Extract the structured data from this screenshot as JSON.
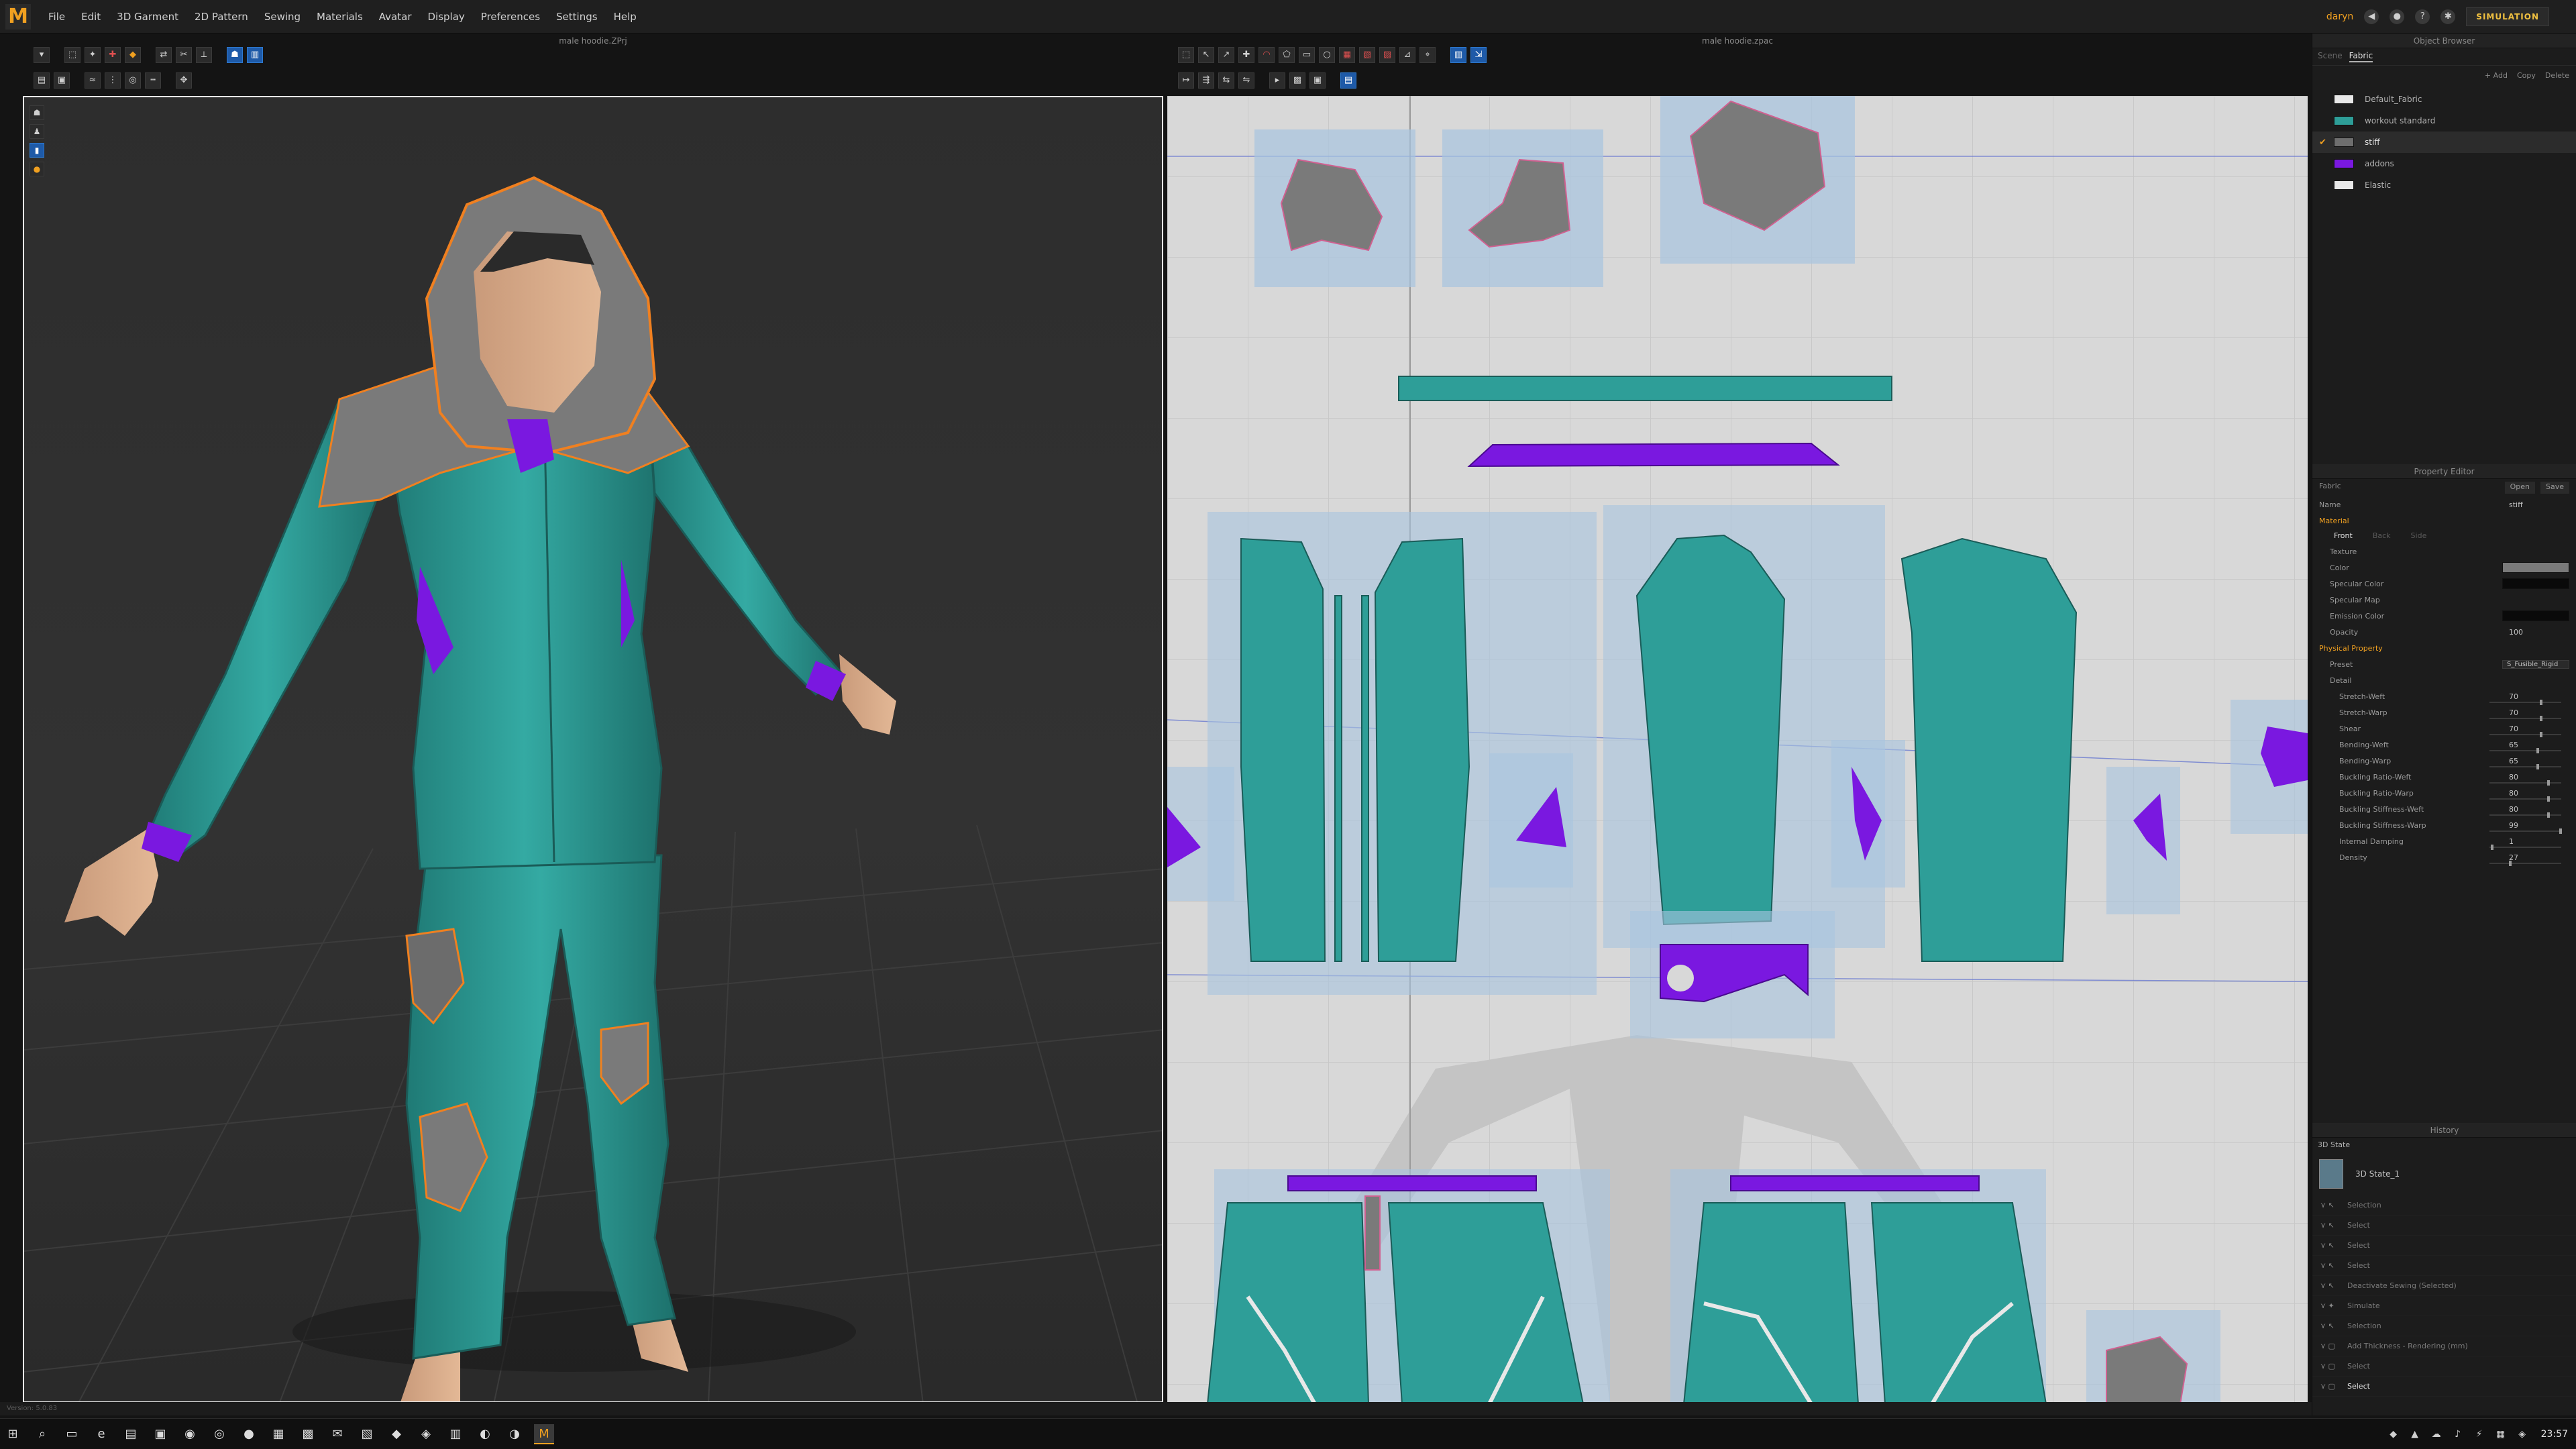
{
  "menubar": {
    "logo": "M",
    "items": [
      "File",
      "Edit",
      "3D Garment",
      "2D Pattern",
      "Sewing",
      "Materials",
      "Avatar",
      "Display",
      "Preferences",
      "Settings",
      "Help"
    ],
    "user_label": "daryn",
    "simulation_label": "SIMULATION"
  },
  "viewport3d": {
    "title": "male hoodie.ZPrj"
  },
  "viewport2d": {
    "title": "male hoodie.zpac"
  },
  "object_browser": {
    "title": "Object Browser",
    "tabs": [
      "Scene",
      "Fabric"
    ],
    "active_tab": "Fabric",
    "actions": [
      "+ Add",
      "Copy",
      "Delete"
    ],
    "fabrics": [
      {
        "name": "Default_Fabric",
        "color": "#e8e8e8",
        "selected": false
      },
      {
        "name": "workout standard",
        "color": "#2e9e98",
        "selected": false
      },
      {
        "name": "stiff",
        "color": "#6e6e6e",
        "selected": true
      },
      {
        "name": "addons",
        "color": "#7a18e0",
        "selected": false
      },
      {
        "name": "Elastic",
        "color": "#e8e8e8",
        "selected": false
      }
    ]
  },
  "property_editor": {
    "title": "Property Editor",
    "object": "Fabric",
    "open_label": "Open",
    "save_label": "Save",
    "name_label": "Name",
    "name_value": "stiff",
    "material_label": "Material",
    "face_tabs": [
      "Front",
      "Back",
      "Side"
    ],
    "texture_label": "Texture",
    "color_label": "Color",
    "color_value": "#7a7a7a",
    "specular_color_label": "Specular Color",
    "specular_map_label": "Specular Map",
    "emission_color_label": "Emission Color",
    "opacity_label": "Opacity",
    "opacity_value": "100",
    "physical_label": "Physical Property",
    "preset_label": "Preset",
    "preset_value": "S_Fusible_Rigid",
    "detail_label": "Detail",
    "details": [
      {
        "label": "Stretch-Weft",
        "value": "70"
      },
      {
        "label": "Stretch-Warp",
        "value": "70"
      },
      {
        "label": "Shear",
        "value": "70"
      },
      {
        "label": "Bending-Weft",
        "value": "65"
      },
      {
        "label": "Bending-Warp",
        "value": "65"
      },
      {
        "label": "Buckling Ratio-Weft",
        "value": "80"
      },
      {
        "label": "Buckling Ratio-Warp",
        "value": "80"
      },
      {
        "label": "Buckling Stiffness-Weft",
        "value": "80"
      },
      {
        "label": "Buckling Stiffness-Warp",
        "value": "99"
      },
      {
        "label": "Internal Damping",
        "value": "1"
      },
      {
        "label": "Density",
        "value": "27"
      }
    ]
  },
  "history": {
    "title": "History",
    "state_label": "3D State",
    "state_name": "3D State_1",
    "items": [
      "Selection",
      "Select",
      "Select",
      "Select",
      "Deactivate Sewing (Selected)",
      "Simulate",
      "Selection",
      "Add Thickness - Rendering (mm)",
      "Select",
      "Select"
    ]
  },
  "status": {
    "text": "Version: 5.0.83"
  },
  "taskbar": {
    "apps": [
      "⊞",
      "⌕",
      "▭",
      "e",
      "▤",
      "▣",
      "◉",
      "◎",
      "●",
      "▦",
      "▩",
      "✉",
      "▧",
      "◆",
      "◈",
      "▥",
      "◐",
      "◑",
      "M"
    ],
    "active_app": 18,
    "tray_icons": [
      "◆",
      "▲",
      "☁",
      "♪",
      "⚡",
      "▦",
      "◈"
    ],
    "clock": "23:57"
  },
  "colors": {
    "teal": "#2e9e98",
    "purple": "#7a18e0",
    "gray_fabric": "#7a7a7a",
    "accent": "#f0a020"
  }
}
